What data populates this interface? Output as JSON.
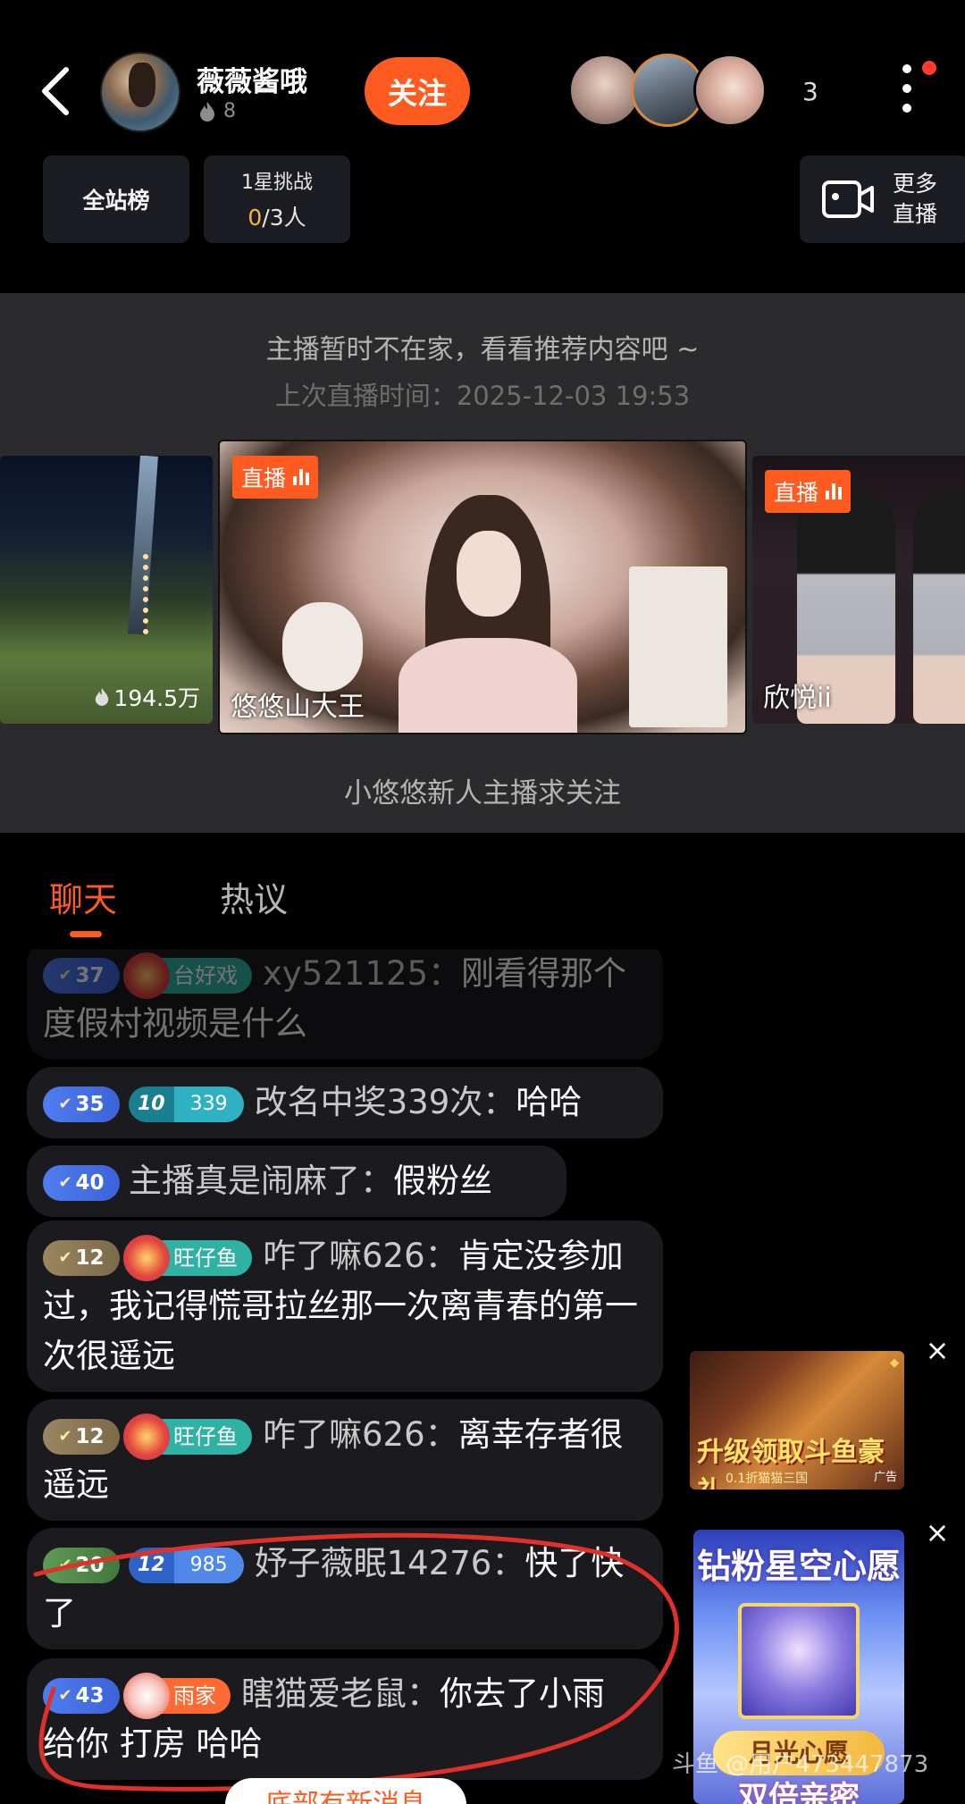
{
  "header": {
    "streamer_name": "薇薇酱哦",
    "hot_value": "8",
    "follow_label": "关注",
    "viewer_count": "3",
    "leaderboard_label": "全站榜",
    "challenge_title": "1星挑战",
    "challenge_current": "0",
    "challenge_total": "/3人",
    "more_live_line1": "更多",
    "more_live_line2": "直播"
  },
  "recommend": {
    "offline_message": "主播暂时不在家，看看推荐内容吧 ~",
    "last_live": "上次直播时间：2025-12-03  19:53",
    "caption": "小悠悠新人主播求关注",
    "cards": [
      {
        "views": "194.5万"
      },
      {
        "live_label": "直播",
        "name": "悠悠山大王"
      },
      {
        "live_label": "直播",
        "name": "欣悦ii"
      }
    ]
  },
  "tabs": {
    "chat": "聊天",
    "hot": "热议"
  },
  "chat": [
    {
      "level": "37",
      "badge": "台好戏",
      "name": "xy521125：",
      "text": "刚看得那个度假村视频是什么"
    },
    {
      "level": "35",
      "fan_num": "10",
      "fan_val": "339",
      "name": "改名中奖339次：",
      "text": "哈哈"
    },
    {
      "level": "40",
      "name": "主播真是闹麻了：",
      "text": "假粉丝"
    },
    {
      "level": "12",
      "badge": "旺仔鱼",
      "name": "咋了嘛626：",
      "text": "肯定没参加过，我记得慌哥拉丝那一次离青春的第一次很遥远"
    },
    {
      "level": "12",
      "badge": "旺仔鱼",
      "name": "咋了嘛626：",
      "text": "离幸存者很遥远"
    },
    {
      "level": "20",
      "fan_num": "12",
      "fan_val": "985",
      "name": "妤子薇眠14276：",
      "text": "快了快了"
    },
    {
      "level": "43",
      "badge": "雨家",
      "name": "瞎猫爱老鼠：",
      "text": "你去了小雨 给你 打房  哈哈"
    }
  ],
  "new_message_pill": "底部有新消息",
  "ads": {
    "ad1_title": "升级领取斗鱼豪礼",
    "ad1_sub": "0.1折猫猫三国",
    "ad1_tag": "广告",
    "ad2_title": "钻粉星空心愿",
    "ad2_wish": "月光心愿",
    "ad2_double": "双倍亲密"
  },
  "watermark": "斗鱼 @用户473447873",
  "colors": {
    "accent": "#ff5a1f",
    "background": "#000000",
    "panel": "#2b2b2d"
  }
}
